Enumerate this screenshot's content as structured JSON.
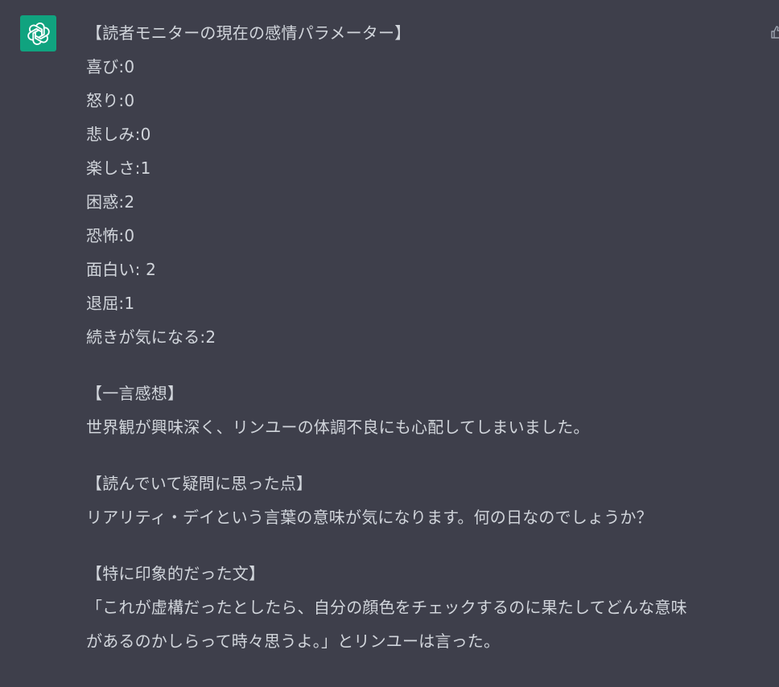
{
  "assistant": {
    "avatar_icon": "openai-logo-icon",
    "avatar_color": "#10a37f"
  },
  "edge_icon": "thumbs-up-icon",
  "message": {
    "heading": "【読者モニターの現在の感情パラメーター】",
    "parameters": [
      {
        "label": "喜び",
        "sep": ":",
        "value": "0"
      },
      {
        "label": "怒り",
        "sep": ":",
        "value": "0"
      },
      {
        "label": "悲しみ",
        "sep": ":",
        "value": "0"
      },
      {
        "label": "楽しさ",
        "sep": ":",
        "value": "1"
      },
      {
        "label": "困惑",
        "sep": ":",
        "value": "2"
      },
      {
        "label": "恐怖",
        "sep": ":",
        "value": "0"
      },
      {
        "label": "面白い",
        "sep": ": ",
        "value": "2"
      },
      {
        "label": "退屈",
        "sep": ":",
        "value": "1"
      },
      {
        "label": "続きが気になる",
        "sep": ":",
        "value": "2"
      }
    ],
    "sections": [
      {
        "title": "【一言感想】",
        "lines": [
          "世界観が興味深く、リンユーの体調不良にも心配してしまいました。"
        ]
      },
      {
        "title": "【読んでいて疑問に思った点】",
        "lines": [
          "リアリティ・デイという言葉の意味が気になります。何の日なのでしょうか？"
        ]
      },
      {
        "title": "【特に印象的だった文】",
        "lines": [
          "「これが虚構だったとしたら、自分の顔色をチェックするのに果たしてどんな意味",
          "があるのかしらって時々思うよ。」とリンユーは言った。"
        ]
      }
    ]
  }
}
